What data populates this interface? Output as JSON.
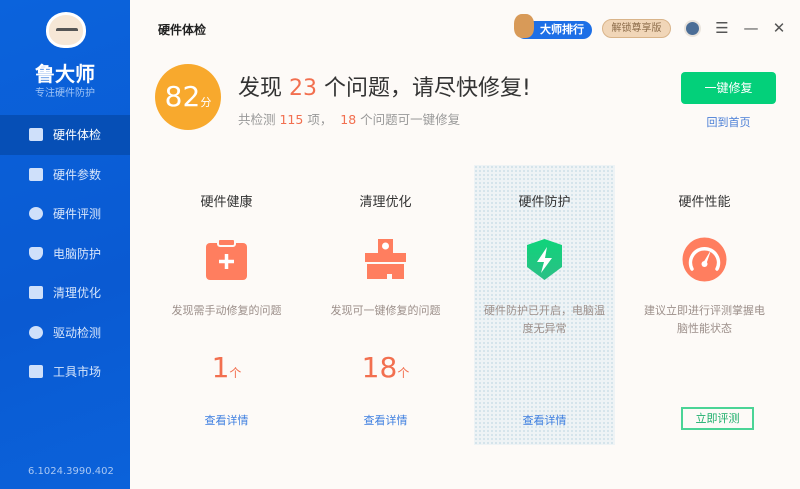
{
  "sidebar": {
    "logo_name": "鲁大师",
    "logo_sub": "专注硬件防护",
    "version": "6.1024.3990.402",
    "items": [
      {
        "label": "硬件体检"
      },
      {
        "label": "硬件参数"
      },
      {
        "label": "硬件评测"
      },
      {
        "label": "电脑防护"
      },
      {
        "label": "清理优化"
      },
      {
        "label": "驱动检测"
      },
      {
        "label": "工具市场"
      }
    ]
  },
  "header": {
    "title": "硬件体检",
    "rank_label": "大师排行",
    "vip_label": "解锁尊享版",
    "menu": "☰",
    "minimize": "—",
    "close": "✕"
  },
  "summary": {
    "score": "82",
    "score_unit": "分",
    "headline_pre": "发现 ",
    "issues": "23",
    "headline_post": " 个问题，请尽快修复!",
    "checked_pre": "共检测 ",
    "checked": "115",
    "checked_mid": " 项，  ",
    "fixable": "18",
    "checked_post": " 个问题可一键修复",
    "fix_button": "一键修复",
    "home_link": "回到首页"
  },
  "columns": [
    {
      "title": "硬件健康",
      "desc": "发现需手动修复的问题",
      "count": "1",
      "unit": "个",
      "link": "查看详情"
    },
    {
      "title": "清理优化",
      "desc": "发现可一键修复的问题",
      "count": "18",
      "unit": "个",
      "link": "查看详情"
    },
    {
      "title": "硬件防护",
      "desc": "硬件防护已开启，电脑温度无异常",
      "link": "查看详情"
    },
    {
      "title": "硬件性能",
      "desc": "建议立即进行评测掌握电脑性能状态",
      "button": "立即评测"
    }
  ],
  "colors": {
    "accent": "#f26f4f",
    "green": "#03d07a",
    "sidebar": "#0b63dc",
    "score": "#f8a92d"
  }
}
